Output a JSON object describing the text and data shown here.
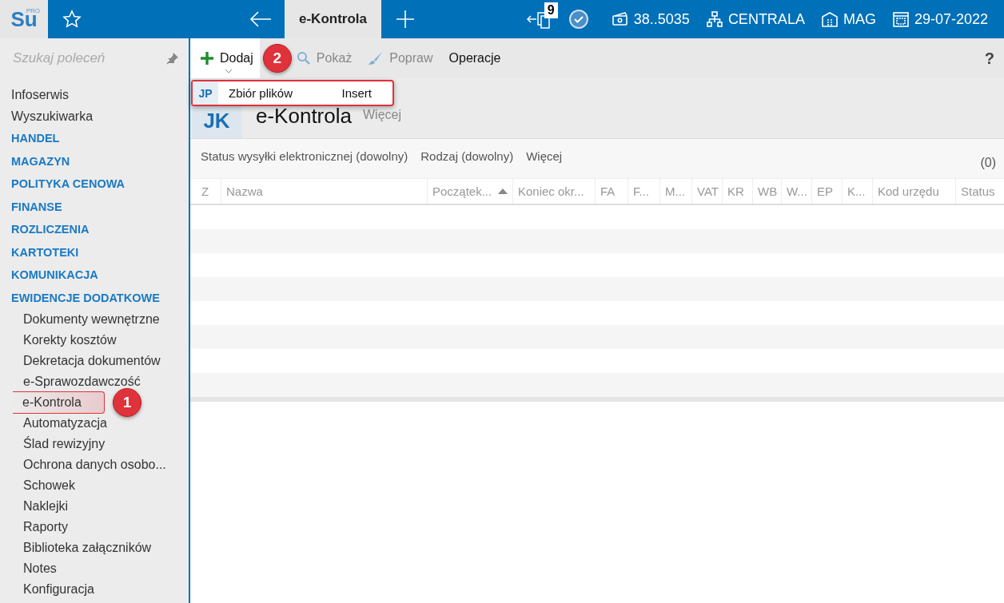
{
  "topbar": {
    "logo": {
      "main": "Su",
      "sup": "PRO"
    },
    "tab": {
      "label": "e-Kontrola",
      "selected": true
    },
    "badge": "9",
    "items": [
      {
        "kind": "cash",
        "label": "38..5035"
      },
      {
        "kind": "org",
        "label": "CENTRALA"
      },
      {
        "kind": "warehouse",
        "label": "MAG"
      },
      {
        "kind": "calendar",
        "label": "29-07-2022"
      }
    ]
  },
  "sidebar": {
    "search": {
      "placeholder": "Szukaj poleceń"
    },
    "items": [
      {
        "kind": "link",
        "label": "Infoserwis"
      },
      {
        "kind": "link",
        "label": "Wyszukiwarka"
      },
      {
        "kind": "section",
        "label": "HANDEL"
      },
      {
        "kind": "section",
        "label": "MAGAZYN"
      },
      {
        "kind": "section",
        "label": "POLITYKA CENOWA"
      },
      {
        "kind": "section",
        "label": "FINANSE"
      },
      {
        "kind": "section",
        "label": "ROZLICZENIA"
      },
      {
        "kind": "section",
        "label": "KARTOTEKI"
      },
      {
        "kind": "section",
        "label": "KOMUNIKACJA"
      },
      {
        "kind": "section",
        "label": "EWIDENCJE DODATKOWE",
        "children": [
          {
            "label": "Dokumenty wewnętrzne",
            "selected": false
          },
          {
            "label": "Korekty kosztów",
            "selected": false
          },
          {
            "label": "Dekretacja dokumentów",
            "selected": false
          },
          {
            "label": "e-Sprawozdawczość",
            "selected": false
          },
          {
            "label": "e-Kontrola",
            "selected": true,
            "callout": "1"
          },
          {
            "label": "Automatyzacja",
            "selected": false
          },
          {
            "label": "Ślad rewizyjny",
            "selected": false
          },
          {
            "label": "Ochrona danych osobo...",
            "selected": false
          },
          {
            "label": "Schowek",
            "selected": false
          },
          {
            "label": "Naklejki",
            "selected": false
          },
          {
            "label": "Raporty",
            "selected": false
          },
          {
            "label": "Biblioteka załączników",
            "selected": false
          },
          {
            "label": "Notes",
            "selected": false
          },
          {
            "label": "Konfiguracja",
            "selected": false
          }
        ]
      }
    ]
  },
  "toolbar": {
    "buttons": [
      {
        "kind": "add",
        "label": "Dodaj",
        "disabled": false,
        "open": true
      },
      {
        "kind": "show",
        "label": "Pokaż",
        "disabled": true,
        "open": false
      },
      {
        "kind": "edit",
        "label": "Popraw",
        "disabled": true,
        "open": false
      },
      {
        "kind": "plain",
        "label": "Operacje",
        "disabled": false,
        "open": false
      }
    ],
    "help": "?",
    "callout": "2"
  },
  "dropdown": {
    "items": [
      {
        "icon_text": "JP",
        "label": "Zbiór plików",
        "shortcut": "Insert"
      }
    ]
  },
  "header": {
    "tile": "JK",
    "title": "e-Kontrola",
    "more": "Więcej"
  },
  "filters": {
    "items": [
      "Status wysyłki elektronicznej (dowolny)",
      "Rodzaj (dowolny)",
      "Więcej"
    ],
    "count": "(0)"
  },
  "table": {
    "columns": [
      {
        "label": "Z",
        "sorted": false
      },
      {
        "label": "Nazwa",
        "sorted": false
      },
      {
        "label": "Początek...",
        "sorted": true
      },
      {
        "label": "Koniec okr...",
        "sorted": false
      },
      {
        "label": "FA",
        "sorted": false
      },
      {
        "label": "F...",
        "sorted": false
      },
      {
        "label": "M...",
        "sorted": false
      },
      {
        "label": "VAT",
        "sorted": false
      },
      {
        "label": "KR",
        "sorted": false
      },
      {
        "label": "WB",
        "sorted": false
      },
      {
        "label": "W...",
        "sorted": false
      },
      {
        "label": "EP",
        "sorted": false
      },
      {
        "label": "K...",
        "sorted": false
      },
      {
        "label": "Kod urzędu",
        "sorted": false
      },
      {
        "label": "Status",
        "sorted": false
      }
    ]
  }
}
